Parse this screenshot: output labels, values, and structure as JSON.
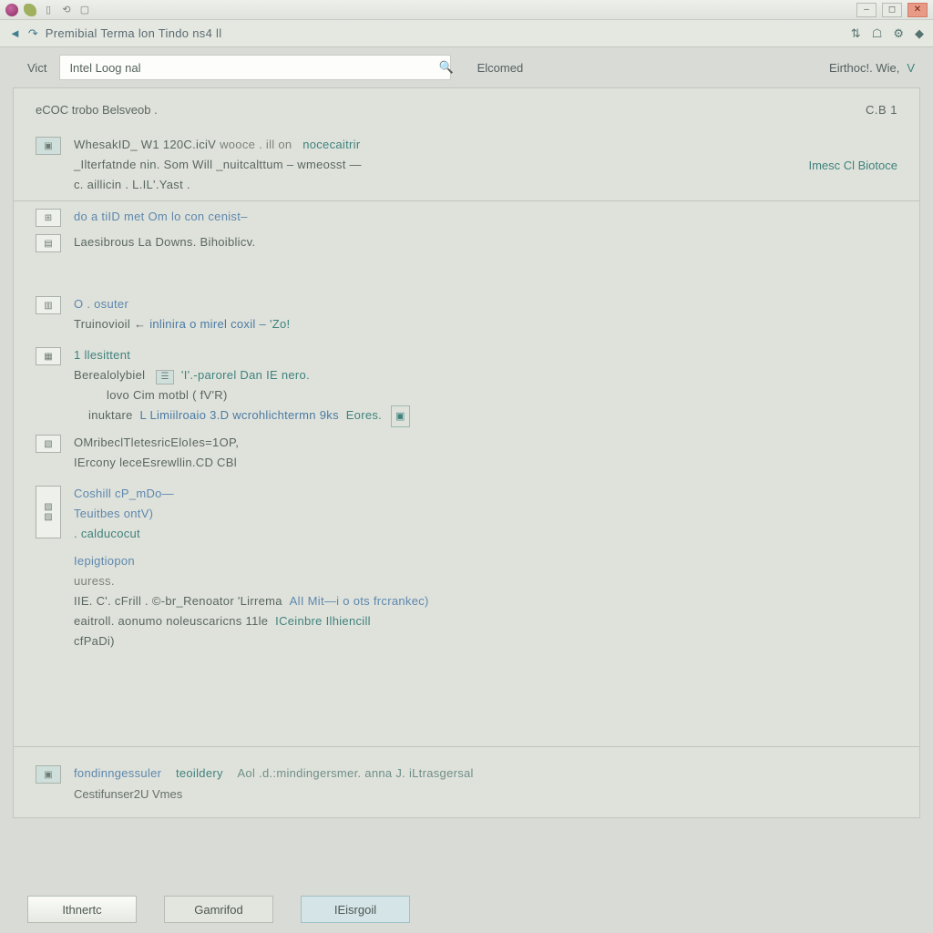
{
  "titlebar": {
    "icons": [
      "globe",
      "leaf",
      "doc",
      "refresh",
      "page"
    ],
    "right_icons": [
      "min",
      "max",
      "close"
    ]
  },
  "toolbar": {
    "path": "Premibial Terma lon Tindo ns4 ll",
    "nav_left": "◄",
    "nav_fwd": "↷"
  },
  "tabs": {
    "left_label": "Vict",
    "search_value": "Intel Loog nal",
    "browse_label": "Elcomed",
    "right_text": "Eirthoc!. Wie,",
    "right_chev": "V"
  },
  "header": {
    "left": "eCOC   trobo   Belsveob .",
    "right": "C.B 1"
  },
  "block1": {
    "line1_a": "WhesakID_ W1   120C.iciV",
    "line1_b": "wooce . ill  on",
    "line1_c": "nocecaitrir",
    "line2": "_Ilterfatnde nin. Som   Will  _nuitcalttum   – wmeosst —",
    "line3": "c.  aillicin .   L.IL'.Yast .",
    "right": "Imesc Cl Biotoce"
  },
  "block2": {
    "line1": "do  a tiID met  Om   lo  con   cenist–",
    "line2": "Laesibrous   La  Downs. Bihoiblicv."
  },
  "block3": {
    "title": "O . osuter",
    "body_a": "Truinovioil   ←",
    "body_b": "inlinira o mirel coxil –",
    "body_c": "'Zo!"
  },
  "block4": {
    "title": "1 llesittent",
    "line2a": "Berealolybiel",
    "line2b": "'I'.-parorel    Dan IE nero.",
    "line3": "lovo Cim  motbl (  fV'R)",
    "line4a": "inuktare",
    "line4b": "L Limiilroaio   3.D    wcrohlichtermn 9ks",
    "line4c": "Eores.",
    "line5": "OMribeclTletesricEloIes=1OP,",
    "line6": "IErcony leceEsrewllin.CD   CBl"
  },
  "block5": {
    "l1": "Coshill   cP_mDo—",
    "l2": "Teuitbes           ontV)",
    "l3": ". calducocut",
    "l4": "Iepigtiopon",
    "l5": "uuress.",
    "l6a": "IIE. C'.   cFrill .  ©-br_Renoator   'Lirrema",
    "l6b": "AlI Mit—i o ots  frcrankec)",
    "l7a": "eaitroll.   aonumo   noleuscaricns  11le",
    "l7b": "ICeinbre    Ilhiencill",
    "l8": "cfPaDi)"
  },
  "related": {
    "link1": "fondinngessuler",
    "link2": "teoildery",
    "mid": "Aol .d.:mindingersmer. anna J.  iLtrasgersal",
    "sub": "Cestifunser2U Vmes"
  },
  "footer": {
    "b1": "Ithnertc",
    "b2": "Gamrifod",
    "b3": "IEisrgoil"
  }
}
